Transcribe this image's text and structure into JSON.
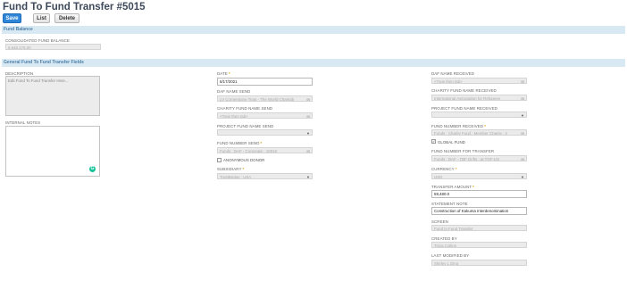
{
  "page": {
    "title": "Fund To Fund Transfer #5015"
  },
  "toolbar": {
    "save_label": "Save",
    "list_label": "List",
    "delete_label": "Delete"
  },
  "sections": {
    "fund_balance": "Fund Balance",
    "general": "General Fund To Fund Transfer Fields"
  },
  "fund_balance": {
    "label": "CONSOLIDATED FUND BALANCE",
    "value": "5,646,176.00"
  },
  "left": {
    "description_label": "DESCRIPTION",
    "description_placeholder": "Edit Fund To Fund Transfer Here...",
    "internal_notes_label": "INTERNAL NOTES"
  },
  "middle": {
    "date_label": "DATE",
    "date_value": "6/17/2021",
    "daf_send_label": "DAF NAME SEND",
    "daf_send_value": "LV Cornerstone Trust - The World Charitab",
    "charity_send_label": "CHARITY FUND NAME SEND",
    "charity_send_value": "<Type then tab>",
    "project_send_label": "PROJECT FUND NAME SEND",
    "project_send_value": "",
    "fund_number_send_label": "FUND NUMBER SEND",
    "fund_number_send_value": "Funds : DAF - Corporate : 10019",
    "anonymous_label": "ANONYMOUS DONOR",
    "subsidiary_label": "SUBSIDIARY",
    "subsidiary_value": "TrustBridge : USA"
  },
  "right": {
    "daf_received_label": "DAF NAME RECEIVED",
    "daf_received_value": "<Type then tab>",
    "charity_received_label": "CHARITY FUND NAME RECEIVED",
    "charity_received_value": "International Association for Refugees",
    "project_received_label": "PROJECT FUND NAME RECEIVED",
    "project_received_value": "",
    "fund_number_received_label": "FUND NUMBER RECEIVED",
    "fund_number_received_value": "Funds : Charity Fund : Member Charity : 2",
    "global_fund_label": "GLOBAL FUND",
    "fund_number_transfer_label": "FUND NUMBER FOR TRANSFER",
    "fund_number_transfer_value": "Funds : DAF - TBF Drifts : at TGF-US",
    "currency_label": "CURRENCY",
    "currency_value": "USD",
    "transfer_amount_label": "TRANSFER AMOUNT",
    "transfer_amount_value": "59,480.0",
    "statement_note_label": "STATEMENT NOTE",
    "statement_note_value": "Construction of Kakuma Interdenomination",
    "screen_label": "SCREEN",
    "screen_value": "Fund to Fund Transfer",
    "created_by_label": "CREATED BY",
    "created_by_value": "Tricia Collins",
    "last_modified_label": "LAST MODIFIED BY",
    "last_modified_value": "Shirley L Ding"
  },
  "icons": {
    "dropdown": "chevron-down-icon",
    "lock": "lock-icon",
    "grammarly": "grammarly-icon"
  },
  "colors": {
    "primary_button": "#2f86d8",
    "section_bg": "#d9e9f3",
    "section_text": "#4b7faa",
    "required": "#e0a500",
    "title": "#3e4a5c"
  }
}
